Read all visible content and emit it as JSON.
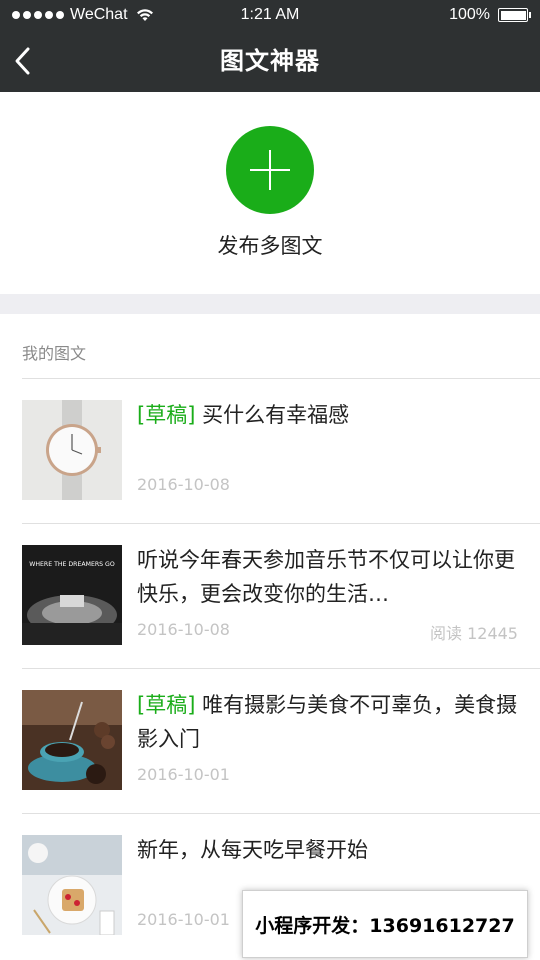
{
  "status_bar": {
    "carrier": "WeChat",
    "time": "1:21 AM",
    "battery": "100%"
  },
  "nav": {
    "title": "图文神器",
    "back_icon": "chevron-left-icon"
  },
  "publish": {
    "button_icon": "plus-icon",
    "label": "发布多图文"
  },
  "section": {
    "title": "我的图文"
  },
  "items": [
    {
      "tag": "[草稿]",
      "title": "买什么有幸福感",
      "date": "2016-10-08",
      "reads": "",
      "thumb": "watch"
    },
    {
      "tag": "",
      "title": "听说今年春天参加音乐节不仅可以让你更快乐，更会改变你的生活…",
      "date": "2016-10-08",
      "reads": "阅读 12445",
      "thumb": "concert",
      "thumb_text": "WHERE THE DREAMERS GO"
    },
    {
      "tag": "[草稿]",
      "title": "唯有摄影与美食不可辜负，美食摄影入门",
      "date": "2016-10-01",
      "reads": "",
      "thumb": "coffee"
    },
    {
      "tag": "",
      "title": "新年，从每天吃早餐开始",
      "date": "2016-10-01",
      "reads": "",
      "thumb": "breakfast"
    }
  ],
  "promo": {
    "text": "小程序开发：13691612727"
  },
  "colors": {
    "accent": "#1aad19",
    "navbar": "#2e3132",
    "muted": "#c4c4c4"
  }
}
